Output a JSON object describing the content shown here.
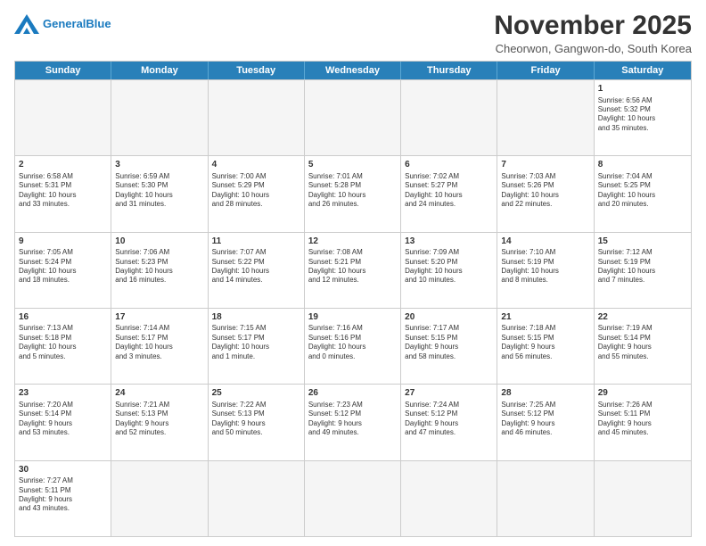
{
  "header": {
    "logo_line1": "General",
    "logo_line2": "Blue",
    "month_title": "November 2025",
    "subtitle": "Cheorwon, Gangwon-do, South Korea"
  },
  "days_of_week": [
    "Sunday",
    "Monday",
    "Tuesday",
    "Wednesday",
    "Thursday",
    "Friday",
    "Saturday"
  ],
  "weeks": [
    [
      {
        "day": "",
        "empty": true
      },
      {
        "day": "",
        "empty": true
      },
      {
        "day": "",
        "empty": true
      },
      {
        "day": "",
        "empty": true
      },
      {
        "day": "",
        "empty": true
      },
      {
        "day": "",
        "empty": true
      },
      {
        "day": "1",
        "info": "Sunrise: 6:56 AM\nSunset: 5:32 PM\nDaylight: 10 hours\nand 35 minutes."
      }
    ],
    [
      {
        "day": "2",
        "info": "Sunrise: 6:58 AM\nSunset: 5:31 PM\nDaylight: 10 hours\nand 33 minutes."
      },
      {
        "day": "3",
        "info": "Sunrise: 6:59 AM\nSunset: 5:30 PM\nDaylight: 10 hours\nand 31 minutes."
      },
      {
        "day": "4",
        "info": "Sunrise: 7:00 AM\nSunset: 5:29 PM\nDaylight: 10 hours\nand 28 minutes."
      },
      {
        "day": "5",
        "info": "Sunrise: 7:01 AM\nSunset: 5:28 PM\nDaylight: 10 hours\nand 26 minutes."
      },
      {
        "day": "6",
        "info": "Sunrise: 7:02 AM\nSunset: 5:27 PM\nDaylight: 10 hours\nand 24 minutes."
      },
      {
        "day": "7",
        "info": "Sunrise: 7:03 AM\nSunset: 5:26 PM\nDaylight: 10 hours\nand 22 minutes."
      },
      {
        "day": "8",
        "info": "Sunrise: 7:04 AM\nSunset: 5:25 PM\nDaylight: 10 hours\nand 20 minutes."
      }
    ],
    [
      {
        "day": "9",
        "info": "Sunrise: 7:05 AM\nSunset: 5:24 PM\nDaylight: 10 hours\nand 18 minutes."
      },
      {
        "day": "10",
        "info": "Sunrise: 7:06 AM\nSunset: 5:23 PM\nDaylight: 10 hours\nand 16 minutes."
      },
      {
        "day": "11",
        "info": "Sunrise: 7:07 AM\nSunset: 5:22 PM\nDaylight: 10 hours\nand 14 minutes."
      },
      {
        "day": "12",
        "info": "Sunrise: 7:08 AM\nSunset: 5:21 PM\nDaylight: 10 hours\nand 12 minutes."
      },
      {
        "day": "13",
        "info": "Sunrise: 7:09 AM\nSunset: 5:20 PM\nDaylight: 10 hours\nand 10 minutes."
      },
      {
        "day": "14",
        "info": "Sunrise: 7:10 AM\nSunset: 5:19 PM\nDaylight: 10 hours\nand 8 minutes."
      },
      {
        "day": "15",
        "info": "Sunrise: 7:12 AM\nSunset: 5:19 PM\nDaylight: 10 hours\nand 7 minutes."
      }
    ],
    [
      {
        "day": "16",
        "info": "Sunrise: 7:13 AM\nSunset: 5:18 PM\nDaylight: 10 hours\nand 5 minutes."
      },
      {
        "day": "17",
        "info": "Sunrise: 7:14 AM\nSunset: 5:17 PM\nDaylight: 10 hours\nand 3 minutes."
      },
      {
        "day": "18",
        "info": "Sunrise: 7:15 AM\nSunset: 5:17 PM\nDaylight: 10 hours\nand 1 minute."
      },
      {
        "day": "19",
        "info": "Sunrise: 7:16 AM\nSunset: 5:16 PM\nDaylight: 10 hours\nand 0 minutes."
      },
      {
        "day": "20",
        "info": "Sunrise: 7:17 AM\nSunset: 5:15 PM\nDaylight: 9 hours\nand 58 minutes."
      },
      {
        "day": "21",
        "info": "Sunrise: 7:18 AM\nSunset: 5:15 PM\nDaylight: 9 hours\nand 56 minutes."
      },
      {
        "day": "22",
        "info": "Sunrise: 7:19 AM\nSunset: 5:14 PM\nDaylight: 9 hours\nand 55 minutes."
      }
    ],
    [
      {
        "day": "23",
        "info": "Sunrise: 7:20 AM\nSunset: 5:14 PM\nDaylight: 9 hours\nand 53 minutes."
      },
      {
        "day": "24",
        "info": "Sunrise: 7:21 AM\nSunset: 5:13 PM\nDaylight: 9 hours\nand 52 minutes."
      },
      {
        "day": "25",
        "info": "Sunrise: 7:22 AM\nSunset: 5:13 PM\nDaylight: 9 hours\nand 50 minutes."
      },
      {
        "day": "26",
        "info": "Sunrise: 7:23 AM\nSunset: 5:12 PM\nDaylight: 9 hours\nand 49 minutes."
      },
      {
        "day": "27",
        "info": "Sunrise: 7:24 AM\nSunset: 5:12 PM\nDaylight: 9 hours\nand 47 minutes."
      },
      {
        "day": "28",
        "info": "Sunrise: 7:25 AM\nSunset: 5:12 PM\nDaylight: 9 hours\nand 46 minutes."
      },
      {
        "day": "29",
        "info": "Sunrise: 7:26 AM\nSunset: 5:11 PM\nDaylight: 9 hours\nand 45 minutes."
      }
    ],
    [
      {
        "day": "30",
        "info": "Sunrise: 7:27 AM\nSunset: 5:11 PM\nDaylight: 9 hours\nand 43 minutes."
      },
      {
        "day": "",
        "empty": true
      },
      {
        "day": "",
        "empty": true
      },
      {
        "day": "",
        "empty": true
      },
      {
        "day": "",
        "empty": true
      },
      {
        "day": "",
        "empty": true
      },
      {
        "day": "",
        "empty": true
      }
    ]
  ]
}
